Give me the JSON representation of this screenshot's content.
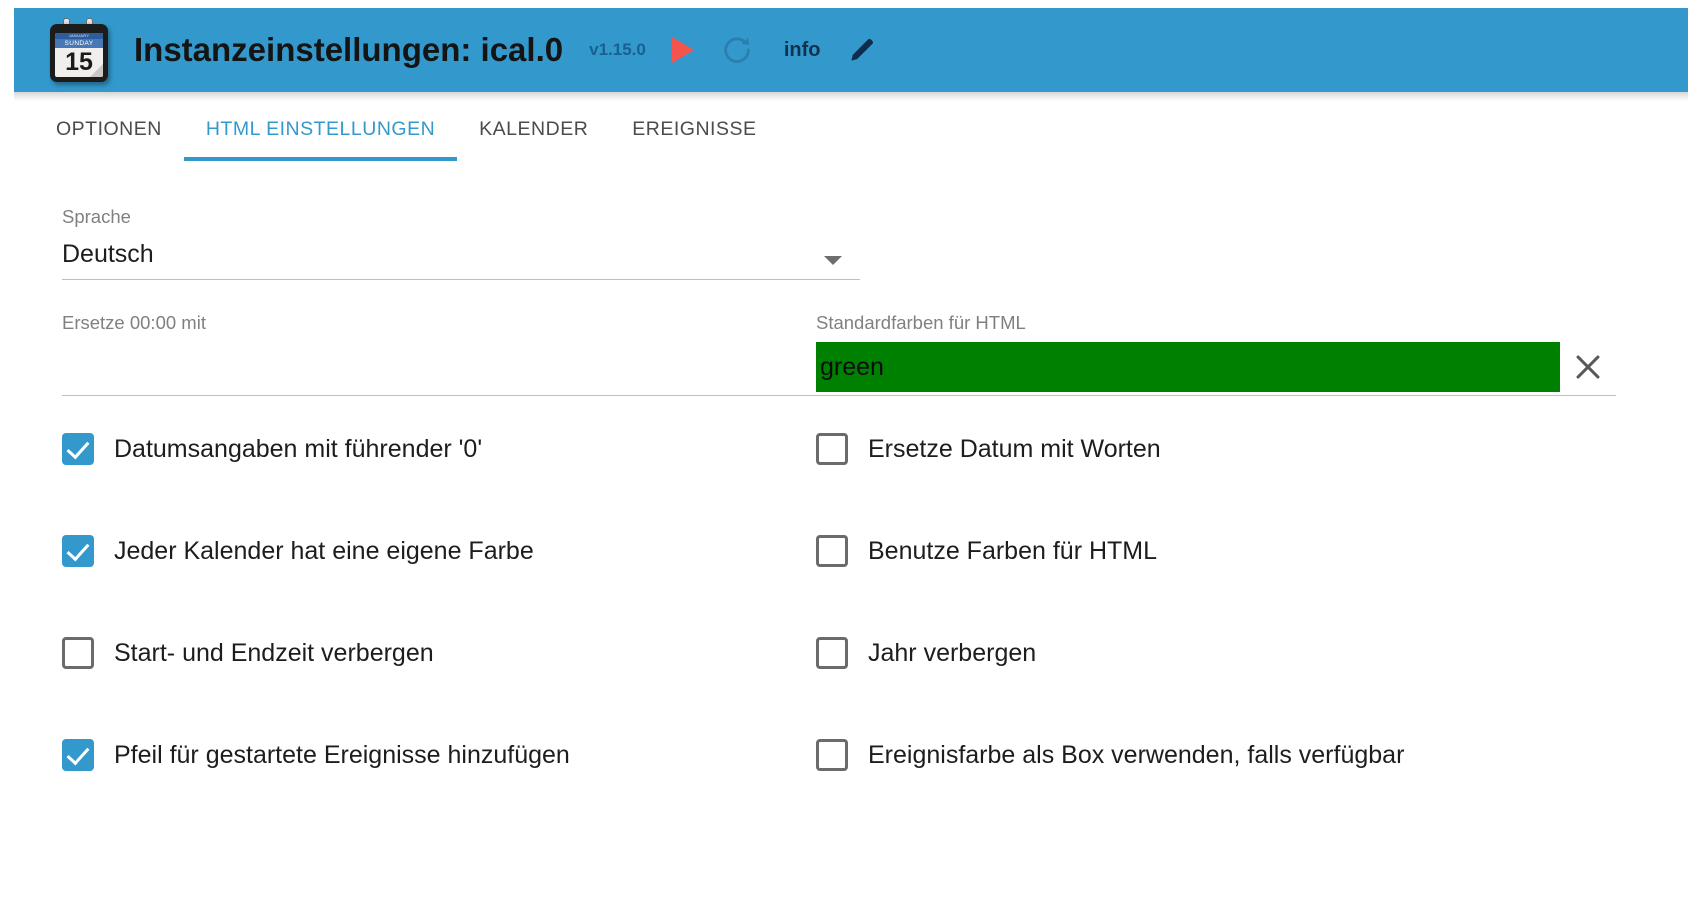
{
  "header": {
    "title": "Instanzeinstellungen: ical.0",
    "version": "v1.15.0",
    "icons": {
      "calendar": "calendar-icon",
      "play": "play-icon",
      "refresh": "refresh-icon",
      "pencil": "pencil-icon"
    },
    "calendar_icon": {
      "month": "JANUARY",
      "weekday": "SUNDAY",
      "day": "15"
    },
    "info_label": "info",
    "background_color": "#3399cc",
    "play_color": "#f5544c",
    "version_color": "#19618f"
  },
  "tabs": [
    {
      "label": "OPTIONEN",
      "active": false
    },
    {
      "label": "HTML EINSTELLUNGEN",
      "active": true
    },
    {
      "label": "KALENDER",
      "active": false
    },
    {
      "label": "EREIGNISSE",
      "active": false
    }
  ],
  "accent_color": "#3399cc",
  "form": {
    "language": {
      "label": "Sprache",
      "value": "Deutsch"
    },
    "replace_midnight": {
      "label": "Ersetze 00:00 mit",
      "value": "",
      "placeholder": ""
    },
    "default_colors": {
      "label": "Standardfarben für HTML",
      "value": "green",
      "placeholder": "",
      "swatch_color": "#008000"
    }
  },
  "checkboxes": {
    "rows": [
      {
        "left": {
          "label": "Datumsangaben mit führender '0'",
          "checked": true
        },
        "right": {
          "label": "Ersetze Datum mit Worten",
          "checked": false
        }
      },
      {
        "left": {
          "label": "Jeder Kalender hat eine eigene Farbe",
          "checked": true
        },
        "right": {
          "label": "Benutze Farben für HTML",
          "checked": false
        }
      },
      {
        "left": {
          "label": "Start- und Endzeit verbergen",
          "checked": false
        },
        "right": {
          "label": "Jahr verbergen",
          "checked": false
        }
      },
      {
        "left": {
          "label": "Pfeil für gestartete Ereignisse hinzufügen",
          "checked": true
        },
        "right": {
          "label": "Ereignisfarbe als Box verwenden, falls verfügbar",
          "checked": false
        }
      }
    ]
  }
}
